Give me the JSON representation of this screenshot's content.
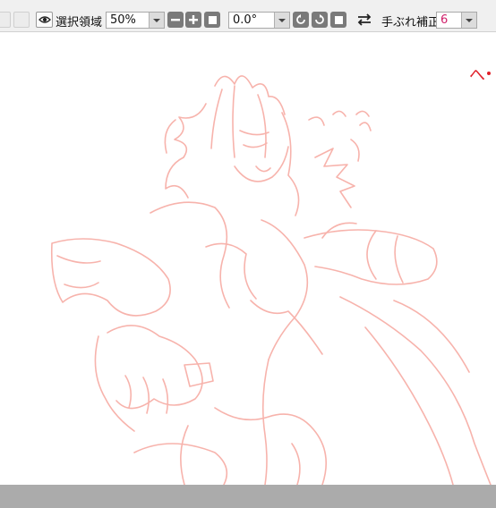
{
  "toolbar": {
    "selection_label": "選択領域",
    "zoom_value": "50%",
    "rotation_value": "0.0°",
    "stabilizer_label": "手ぶれ補正",
    "stabilizer_value": "6"
  },
  "canvas": {
    "stroke_color": "#f7b3ac",
    "text_color": "#e0202a",
    "corner_text": "へ"
  },
  "icons": [
    "eye-icon",
    "chevron-down-icon",
    "minus-icon",
    "plus-icon",
    "square-icon",
    "rotate-left-icon",
    "rotate-right-icon",
    "swap-icon"
  ]
}
